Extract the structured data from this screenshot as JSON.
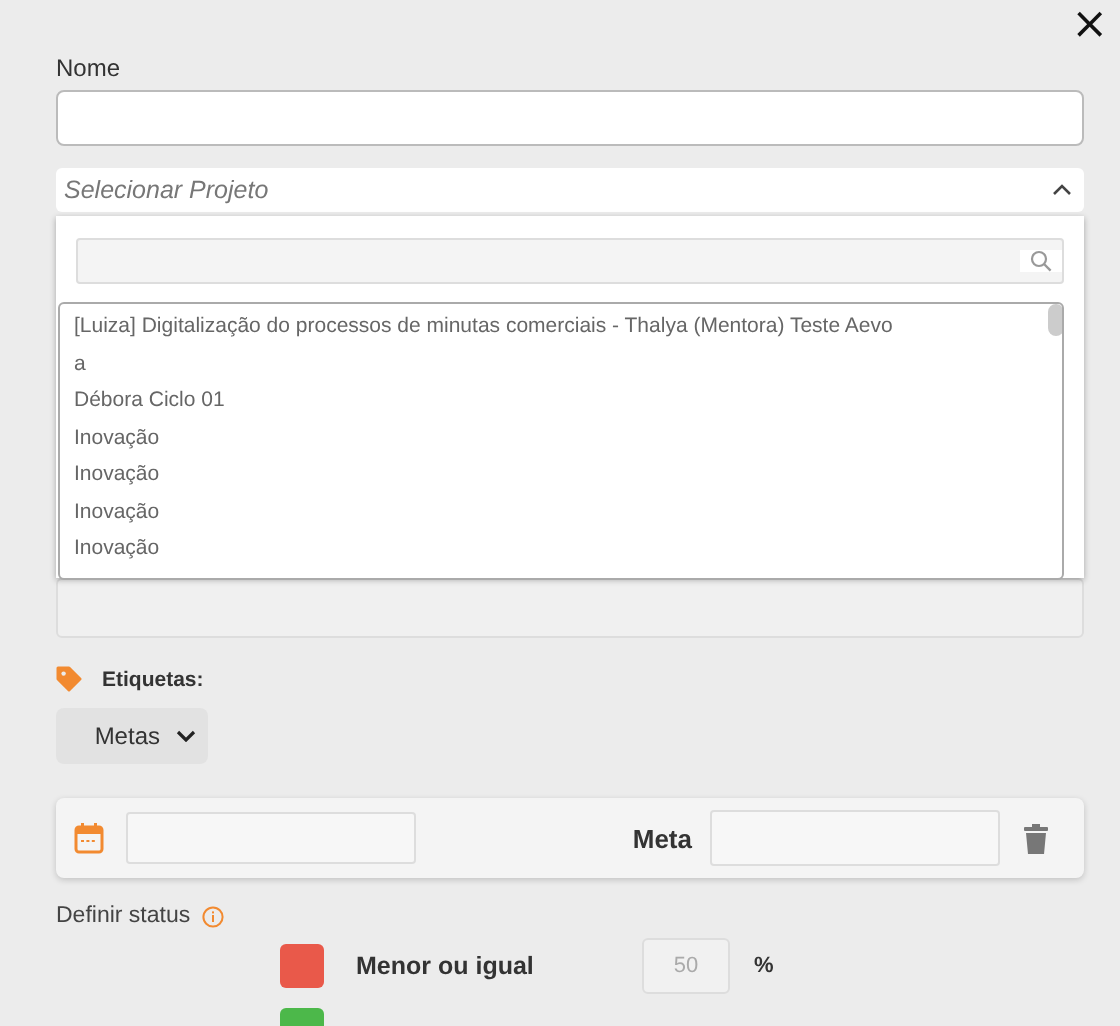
{
  "close_label": "×",
  "name_field": {
    "label": "Nome"
  },
  "project_select": {
    "placeholder": "Selecionar Projeto",
    "expanded": true,
    "options": [
      {
        "label": "[Luiza] Digitalização do processos de minutas comerciais - Thalya (Mentora) Teste Aevo"
      },
      {
        "label": "a"
      },
      {
        "label": "Débora Ciclo 01"
      },
      {
        "label": "Inovação"
      },
      {
        "label": "Inovação"
      },
      {
        "label": "Inovação"
      },
      {
        "label": "Inovação"
      }
    ]
  },
  "tags": {
    "label": "Etiquetas:",
    "select": {
      "value": "Metas"
    }
  },
  "goal_row": {
    "meta_label": "Meta"
  },
  "status": {
    "label": "Definir status",
    "items": [
      {
        "color": "#e9594a",
        "label": "Menor ou igual",
        "value": "50",
        "unit": "%"
      },
      {
        "color": "#4cb84a"
      }
    ]
  }
}
